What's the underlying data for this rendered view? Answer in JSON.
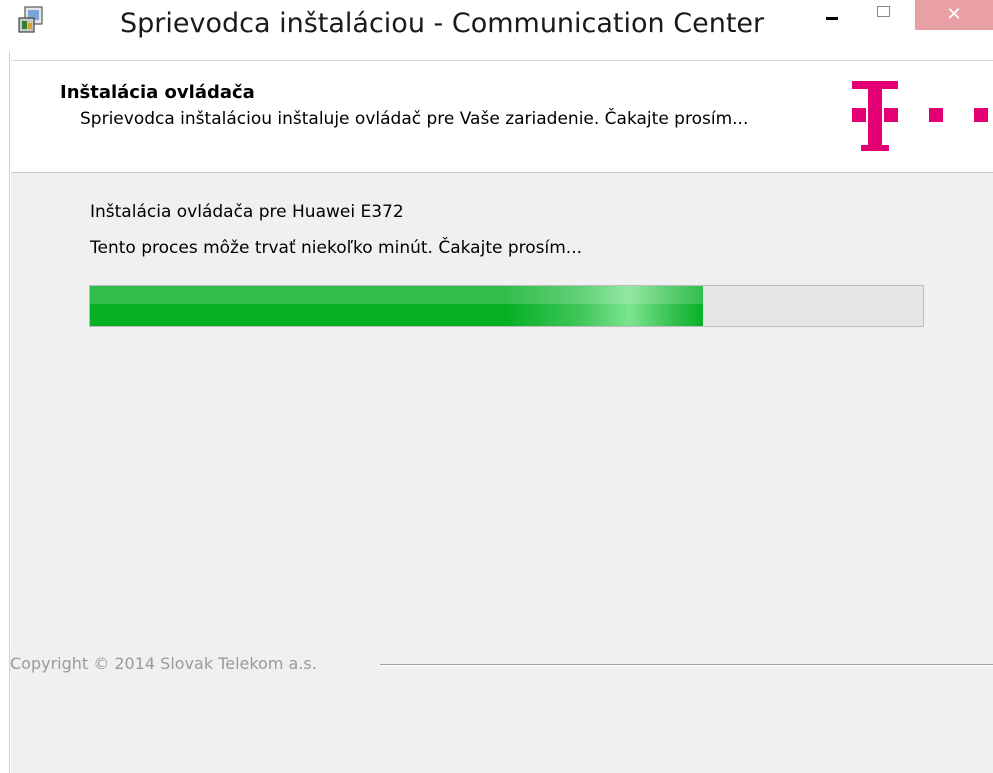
{
  "window": {
    "title": "Sprievodca inštaláciou - Communication Center",
    "close_glyph": "✕"
  },
  "header": {
    "title": "Inštalácia ovládača",
    "description": "Sprievodca inštaláciou inštaluje ovládač pre Vaše zariadenie. Čakajte prosím...",
    "logo": "telekom-t-logo",
    "logo_color": "#e20074"
  },
  "main": {
    "status_line": "Inštalácia ovládača pre Huawei E372",
    "wait_line": "Tento proces môže trvať niekoľko minút. Čakajte prosím...",
    "progress_fraction": 0.736
  },
  "footer": {
    "copyright": "Copyright © 2014 Slovak Telekom a.s."
  },
  "colors": {
    "accent": "#e20074",
    "progress": "#06b025",
    "close_button": "#e8a0a4"
  }
}
